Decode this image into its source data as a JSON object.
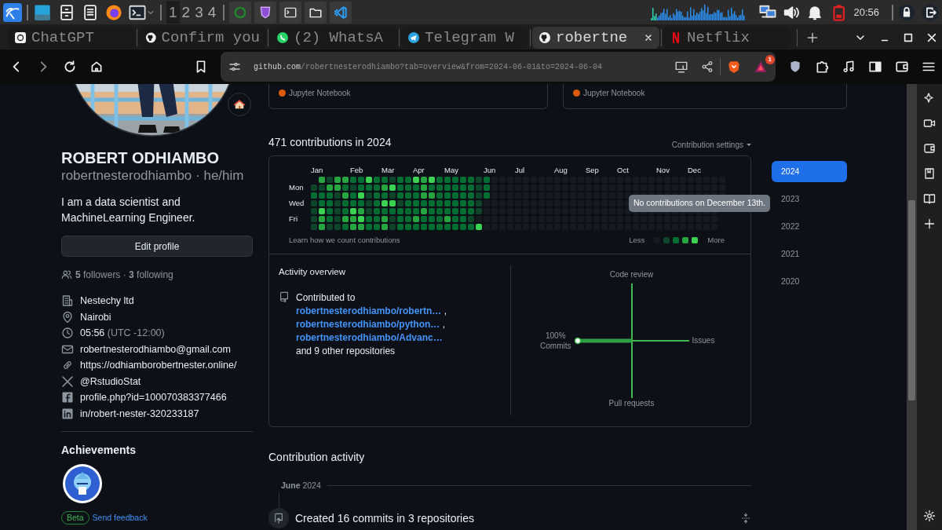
{
  "taskbar": {
    "workspaces": [
      {
        "label": "1",
        "selected": true
      },
      {
        "label": "2",
        "selected": false
      },
      {
        "label": "3",
        "selected": false
      },
      {
        "label": "4",
        "selected": false
      }
    ],
    "clock": "20:56"
  },
  "tabs": [
    {
      "kind": "chatgpt",
      "title": "ChatGPT",
      "selected": false
    },
    {
      "kind": "github",
      "title": "Confirm you",
      "selected": false
    },
    {
      "kind": "whatsapp",
      "title": "(2) WhatsA",
      "selected": false
    },
    {
      "kind": "telegram",
      "title": "Telegram W",
      "selected": false
    },
    {
      "kind": "github",
      "title": "robertne",
      "selected": true
    },
    {
      "kind": "netflix",
      "title": "Netflix",
      "selected": false
    }
  ],
  "address_bar": {
    "host": "github.com",
    "path": "/robertnesterodhiambo?tab=overview&from=2024-06-01&to=2024-06-04",
    "extension_badge": "1"
  },
  "pinned_repos": [
    {
      "language": "Jupyter Notebook",
      "color": "#da5b0b"
    },
    {
      "language": "Jupyter Notebook",
      "color": "#da5b0b"
    }
  ],
  "profile": {
    "name": "ROBERT ODHIAMBO",
    "username": "robertnesterodhiambo · he/him",
    "bio": "I am a data scientist and MachineLearning Engineer.",
    "edit_button": "Edit profile",
    "follow": "**5** followers · **3** following",
    "details": [
      {
        "kind": "building",
        "text": "Nestechy ltd"
      },
      {
        "kind": "location",
        "text": "Nairobi"
      },
      {
        "kind": "clock",
        "text": "05:56",
        "note": "(UTC -12:00)"
      },
      {
        "kind": "mail",
        "text": "robertnesterodhiambo@gmail.com"
      },
      {
        "kind": "link",
        "text": "https://odhiamborobertnester.online/"
      },
      {
        "kind": "x",
        "text": "@RstudioStat"
      },
      {
        "kind": "facebook",
        "text": "profile.php?id=100070383377466"
      },
      {
        "kind": "linkedin",
        "text": "in/robert-nester-320233187"
      }
    ],
    "achievements_title": "Achievements",
    "beta": "Beta",
    "feedback": "Send feedback"
  },
  "contributions": {
    "title": "471 contributions in 2024",
    "settings": "Contribution settings",
    "months": [
      "Jan",
      "Feb",
      "Mar",
      "Apr",
      "May",
      "Jun",
      "Jul",
      "Aug",
      "Sep",
      "Oct",
      "Nov",
      "Dec"
    ],
    "day_labels": [
      "Mon",
      "Wed",
      "Fri"
    ],
    "tooltip": "No contributions on December 13th.",
    "learn": "Learn how we count contributions",
    "less": "Less",
    "more": "More"
  },
  "activity": {
    "title": "Activity overview",
    "intro": "Contributed to",
    "repos": [
      {
        "name": "robertnesterodhiambo/robertn…",
        "suffix": ","
      },
      {
        "name": "robertnesterodhiambo/python…",
        "suffix": ","
      },
      {
        "name": "robertnesterodhiambo/Advanc…"
      }
    ],
    "others": "and 9 other repositories",
    "axes": [
      {
        "label": "Code review"
      },
      {
        "label": "Commits",
        "percent": "100%",
        "level": 1
      },
      {
        "label": "Issues"
      },
      {
        "label": "Pull requests"
      }
    ]
  },
  "contribution_activity": {
    "title": "Contribution activity",
    "month": "**June** 2024",
    "event": "Created 16 commits in 3 repositories"
  },
  "years": [
    {
      "label": "2024",
      "selected": true
    },
    {
      "label": "2023",
      "selected": false
    },
    {
      "label": "2022",
      "selected": false
    },
    {
      "label": "2021",
      "selected": false
    },
    {
      "label": "2020",
      "selected": false
    }
  ]
}
